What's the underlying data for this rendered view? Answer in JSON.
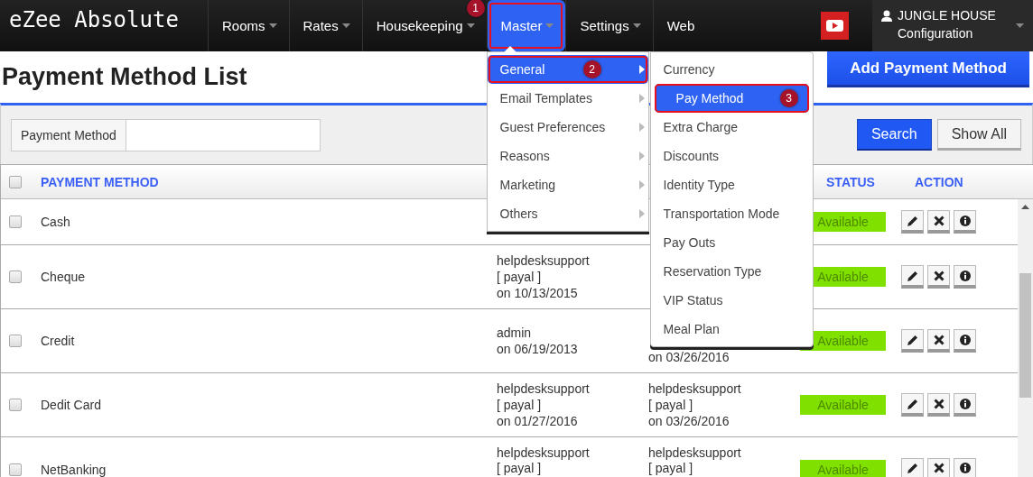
{
  "brand": "eZee Absolute",
  "nav": [
    {
      "label": "Rooms",
      "has_caret": true,
      "selected": false
    },
    {
      "label": "Rates",
      "has_caret": true,
      "selected": false
    },
    {
      "label": "Housekeeping",
      "has_caret": true,
      "selected": false
    },
    {
      "label": "Master",
      "has_caret": true,
      "selected": true,
      "callout": "1"
    },
    {
      "label": "Settings",
      "has_caret": true,
      "selected": false
    },
    {
      "label": "Web",
      "has_caret": false,
      "selected": false
    }
  ],
  "user": {
    "name": "JUNGLE HOUSE",
    "role": "Configuration"
  },
  "page_title": "Payment Method List",
  "add_button": "Add Payment Method",
  "filter": {
    "label": "Payment Method",
    "search_button": "Search",
    "show_all_button": "Show All"
  },
  "table": {
    "header_checked": false,
    "columns": {
      "method": "PAYMENT METHOD",
      "status": "STATUS",
      "action": "ACTION"
    },
    "rows": [
      {
        "checked": false,
        "name": "Cash",
        "status": "Available"
      },
      {
        "checked": false,
        "name": "Cheque",
        "created": [
          "helpdesksupport",
          "[ payal ]",
          "on 10/13/2015"
        ],
        "status": "Available"
      },
      {
        "checked": false,
        "name": "Credit",
        "created": [
          "admin",
          "on 06/19/2013"
        ],
        "updated": [
          "on 03/26/2016"
        ],
        "status": "Available"
      },
      {
        "checked": false,
        "name": "Dedit Card",
        "created": [
          "helpdesksupport",
          "[ payal ]",
          "on 01/27/2016"
        ],
        "updated": [
          "helpdesksupport",
          "[ payal ]",
          "on 03/26/2016"
        ],
        "status": "Available"
      },
      {
        "checked": false,
        "name": "NetBanking",
        "created": [
          "helpdesksupport",
          "[ payal ]"
        ],
        "updated": [
          "helpdesksupport",
          "[ payal ]"
        ],
        "status": "Available"
      }
    ]
  },
  "menu": {
    "items": [
      {
        "label": "General",
        "selected": true,
        "callout": "2"
      },
      {
        "label": "Email Templates",
        "selected": false
      },
      {
        "label": "Guest Preferences",
        "selected": false
      },
      {
        "label": "Reasons",
        "selected": false
      },
      {
        "label": "Marketing",
        "selected": false
      },
      {
        "label": "Others",
        "selected": false
      }
    ]
  },
  "submenu": {
    "items": [
      {
        "label": "Currency",
        "selected": false
      },
      {
        "label": "Pay Method",
        "selected": true,
        "callout": "3"
      },
      {
        "label": "Extra Charge",
        "selected": false
      },
      {
        "label": "Discounts",
        "selected": false
      },
      {
        "label": "Identity Type",
        "selected": false
      },
      {
        "label": "Transportation Mode",
        "selected": false
      },
      {
        "label": "Pay Outs",
        "selected": false
      },
      {
        "label": "Reservation Type",
        "selected": false
      },
      {
        "label": "VIP Status",
        "selected": false
      },
      {
        "label": "Meal Plan",
        "selected": false
      }
    ]
  }
}
